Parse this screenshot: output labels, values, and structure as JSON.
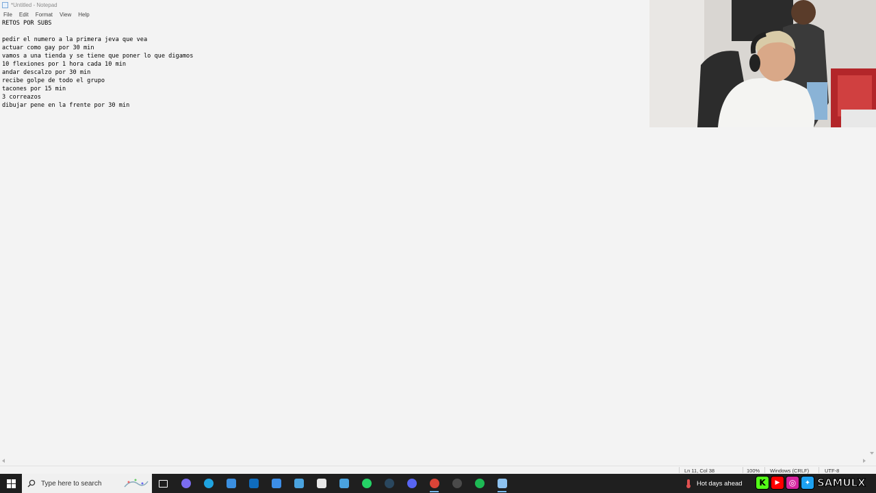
{
  "window": {
    "title": "*Untitled - Notepad"
  },
  "menu": [
    "File",
    "Edit",
    "Format",
    "View",
    "Help"
  ],
  "editor": {
    "lines": [
      "RETOS POR SUBS",
      "",
      "pedir el numero a la primera jeva que vea",
      "actuar como gay por 30 min",
      "vamos a una tienda y se tiene que poner lo que digamos",
      "10 flexiones por 1 hora cada 10 min",
      "andar descalzo por 30 min",
      "recibe golpe de todo el grupo",
      "tacones por 15 min",
      "3 correazos",
      "dibujar pene en la frente por 30 min"
    ]
  },
  "status": {
    "position": "Ln 11, Col 38",
    "zoom": "100%",
    "line_ending": "Windows (CRLF)",
    "encoding": "UTF-8"
  },
  "taskbar": {
    "search_placeholder": "Type here to search",
    "weather": "Hot days ahead",
    "apps": [
      {
        "name": "task-view",
        "color": "#ffffff"
      },
      {
        "name": "copilot",
        "color": "#7b6cf0"
      },
      {
        "name": "edge",
        "color": "#1fa3e0"
      },
      {
        "name": "app-blue",
        "color": "#3b8fe0"
      },
      {
        "name": "outlook",
        "color": "#0f6cbd"
      },
      {
        "name": "store",
        "color": "#3c8ee8"
      },
      {
        "name": "app-window",
        "color": "#4aa3df"
      },
      {
        "name": "app-file",
        "color": "#e8e8e8"
      },
      {
        "name": "app-window-2",
        "color": "#4aa3df"
      },
      {
        "name": "whatsapp",
        "color": "#25d366"
      },
      {
        "name": "steam",
        "color": "#2a475e"
      },
      {
        "name": "app-chat",
        "color": "#5865f2"
      },
      {
        "name": "chrome",
        "color": "#db4437"
      },
      {
        "name": "obs",
        "color": "#4a4a4a"
      },
      {
        "name": "spotify",
        "color": "#1db954"
      },
      {
        "name": "notepad",
        "color": "#8ec3f0"
      }
    ]
  },
  "overlay": {
    "brand": "SAMULX",
    "social": [
      {
        "name": "kick",
        "glyph": "K",
        "color": "#53fc18"
      },
      {
        "name": "youtube",
        "glyph": "▶",
        "color": "#ff0000"
      },
      {
        "name": "instagram",
        "glyph": "◎",
        "color": "#d6249f"
      },
      {
        "name": "twitter",
        "glyph": "✦",
        "color": "#1da1f2"
      }
    ]
  }
}
